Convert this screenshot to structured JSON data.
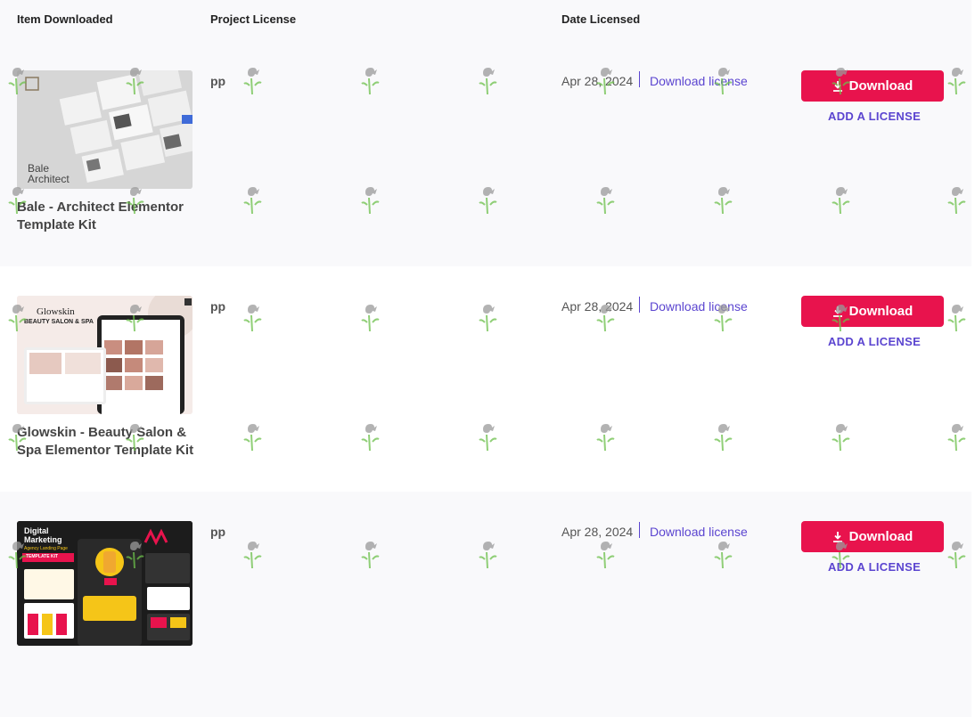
{
  "table": {
    "headers": {
      "item": "Item Downloaded",
      "project": "Project License",
      "date": "Date Licensed"
    },
    "rows": [
      {
        "title": "Bale - Architect Elementor Template Kit",
        "thumb_caption": "Bale Architect",
        "project": "pp",
        "date": "Apr 28, 2024",
        "download_link": "Download license",
        "download_button": "Download",
        "add_license": "ADD A LICENSE"
      },
      {
        "title": "Glowskin - Beauty Salon & Spa Elementor Template Kit",
        "thumb_caption": "Glowskin",
        "thumb_subcaption": "BEAUTY SALON & SPA",
        "project": "pp",
        "date": "Apr 28, 2024",
        "download_link": "Download license",
        "download_button": "Download",
        "add_license": "ADD A LICENSE"
      },
      {
        "title": "",
        "thumb_caption": "Digital Marketing",
        "thumb_subcaption": "Agency Landing Page",
        "thumb_badge": "TEMPLATE KIT",
        "project": "pp",
        "date": "Apr 28, 2024",
        "download_link": "Download license",
        "download_button": "Download",
        "add_license": "ADD A LICENSE"
      }
    ]
  },
  "colors": {
    "accent_red": "#e8134d",
    "link_purple": "#5b45d0",
    "row_alt_bg": "#f9f9fb"
  },
  "icons": {
    "download_button_icon": "download-icon",
    "watermark": "watering-can-icon"
  }
}
